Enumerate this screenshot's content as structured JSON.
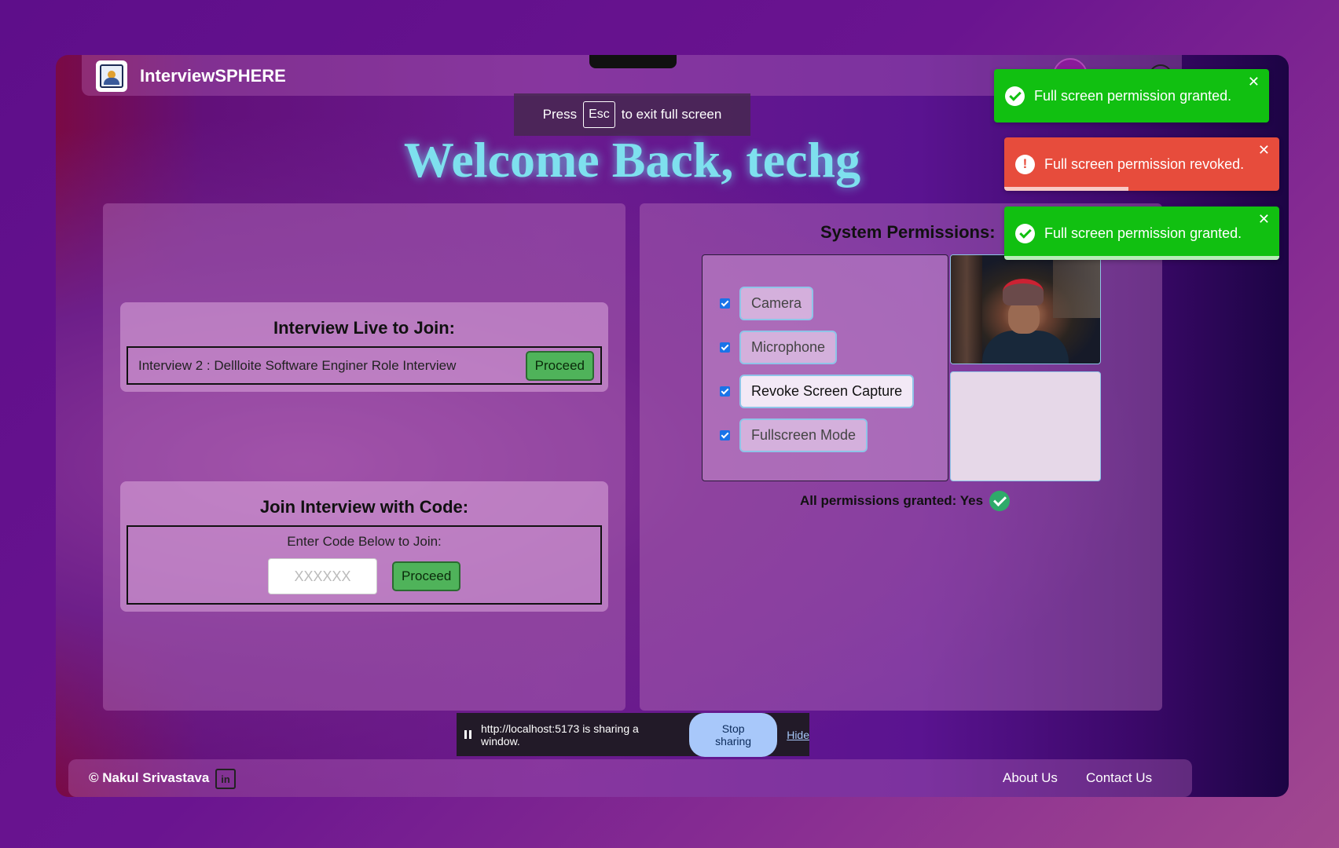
{
  "app": {
    "title": "InterviewSPHERE"
  },
  "fullscreen_banner": {
    "press": "Press",
    "key": "Esc",
    "suffix": "to exit full screen"
  },
  "welcome": "Welcome Back, techg",
  "live_interview": {
    "title": "Interview Live to Join:",
    "item": "Interview 2 : Dellloite Software Enginer Role Interview",
    "proceed_label": "Proceed"
  },
  "join_code": {
    "title": "Join Interview with Code:",
    "label": "Enter Code Below to Join:",
    "placeholder": "XXXXXX",
    "value": "",
    "proceed_label": "Proceed"
  },
  "permissions": {
    "title": "System Permissions:",
    "items": [
      {
        "label": "Camera",
        "checked": true
      },
      {
        "label": "Microphone",
        "checked": true
      },
      {
        "label": "Revoke Screen Capture",
        "checked": true
      },
      {
        "label": "Fullscreen Mode",
        "checked": true
      }
    ],
    "status": "All permissions granted: Yes"
  },
  "toasts": [
    {
      "type": "success",
      "message": "Full screen permission granted.",
      "close": "✕"
    },
    {
      "type": "error",
      "message": "Full screen permission revoked.",
      "close": "✕",
      "progress": 0.45
    },
    {
      "type": "success",
      "message": "Full screen permission granted.",
      "close": "✕",
      "progress": 1.0
    }
  ],
  "share_bar": {
    "message": "http://localhost:5173 is sharing a window.",
    "stop_label": "Stop sharing",
    "hide_label": "Hide"
  },
  "footer": {
    "copyright": "© Nakul Srivastava",
    "linkedin_icon": "in",
    "links": [
      "About Us",
      "Contact Us"
    ]
  },
  "colors": {
    "accent_cyan": "#7ee0ee",
    "success_green": "#11c011",
    "error_red": "#e74c3c",
    "proceed_green": "#4fb35a"
  }
}
